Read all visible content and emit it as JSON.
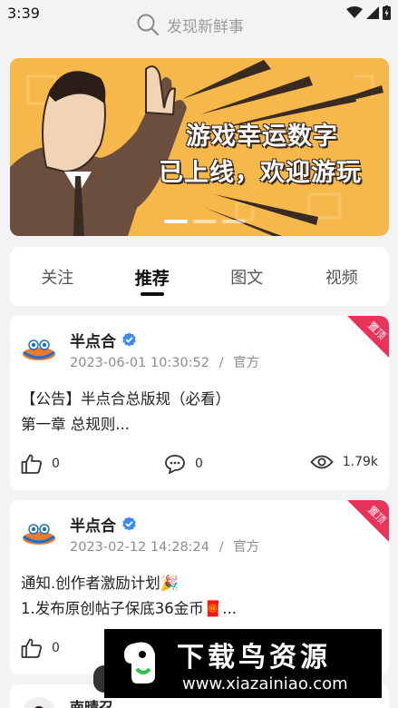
{
  "status": {
    "time": "3:39"
  },
  "search": {
    "placeholder": "发现新鲜事",
    "icon": "search-icon"
  },
  "banner": {
    "line1": "游戏幸运数字",
    "line2": "已上线，欢迎游玩",
    "slides": 3,
    "active_slide": 0
  },
  "tabs": [
    {
      "label": "关注",
      "active": false
    },
    {
      "label": "推荐",
      "active": true
    },
    {
      "label": "图文",
      "active": false
    },
    {
      "label": "视频",
      "active": false
    }
  ],
  "posts": [
    {
      "author": "半点合",
      "verified": true,
      "date": "2023-06-01 10:30:52",
      "sep": "/",
      "role": "官方",
      "pinned_label": "置顶",
      "line1": "【公告】半点合总版规（必看）",
      "line2": "第一章 总规则...",
      "likes": "0",
      "comments": "0",
      "views": "1.79k"
    },
    {
      "author": "半点合",
      "verified": true,
      "date": "2023-02-12 14:28:24",
      "sep": "/",
      "role": "官方",
      "pinned_label": "置顶",
      "line1": "通知.创作者激励计划🎉",
      "line2": "1.发布原创帖子保底36金币🧧...",
      "likes": "0"
    },
    {
      "author": "南晴召"
    }
  ],
  "watermark": {
    "title": "下载鸟资源",
    "url": "www.xiazainiao.com"
  },
  "colors": {
    "banner_bg": "#f7b84b",
    "pin": "#e8335a",
    "verified": "#3a8bf0",
    "page_bg": "#f2f3f5"
  }
}
